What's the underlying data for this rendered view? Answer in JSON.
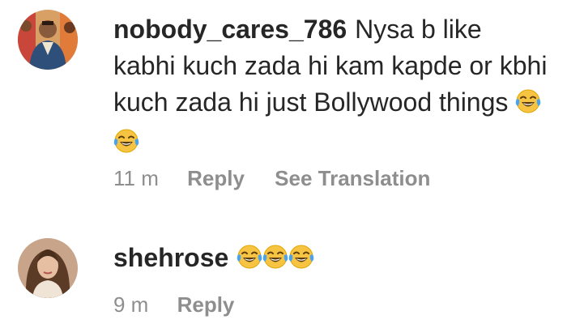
{
  "comments": [
    {
      "username": "nobody_cares_786",
      "text": "Nysa b like kabhi kuch zada hi kam kapde or kbhi kuch zada hi just Bollywood things",
      "emojis": [
        "face-with-tears-of-joy",
        "face-with-tears-of-joy"
      ],
      "time": "11 m",
      "reply_label": "Reply",
      "translate_label": "See Translation"
    },
    {
      "username": "shehrose",
      "text": "",
      "emojis": [
        "face-with-tears-of-joy",
        "face-with-tears-of-joy",
        "face-with-tears-of-joy"
      ],
      "time": "9 m",
      "reply_label": "Reply"
    }
  ],
  "colors": {
    "text": "#262626",
    "secondary": "#8e8e8e",
    "emoji_face": "#f6c342",
    "emoji_tear": "#4aa3ef"
  }
}
